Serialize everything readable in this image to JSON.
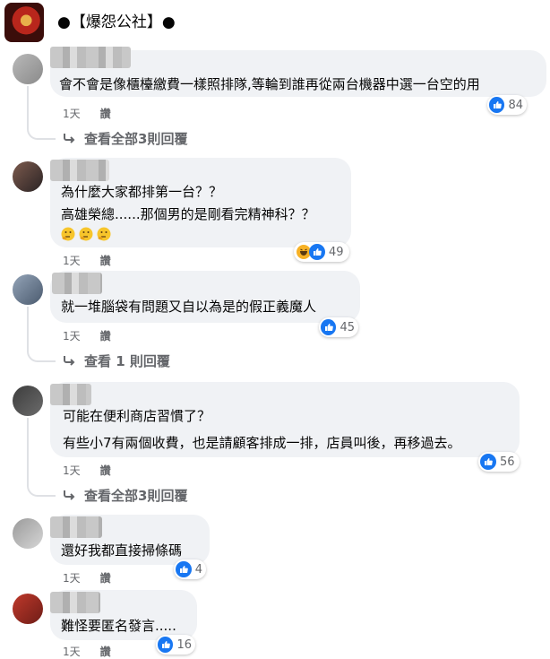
{
  "page": {
    "name": "●【爆怨公社】●"
  },
  "icons": {
    "like": "like-icon",
    "haha": "haha-icon",
    "reply_arrow": "reply-arrow-icon"
  },
  "colors": {
    "like_blue": "#1877f2",
    "bubble_bg": "#f0f2f5",
    "meta_gray": "#65676b"
  },
  "comments": [
    {
      "lines": [
        "會不會是像櫃檯繳費一樣照排隊,等輪到誰再從兩台機器中選一台空的用"
      ],
      "time": "1天",
      "action": "讚",
      "reactions": [
        "like"
      ],
      "count": "84",
      "replies": "查看全部3則回覆"
    },
    {
      "lines": [
        "為什麼大家都排第一台？？",
        "高雄榮總......那個男的是剛看完精神科？？"
      ],
      "emoji_line": [
        "thinking",
        "thinking",
        "thinking"
      ],
      "time": "1天",
      "action": "讚",
      "reactions": [
        "haha",
        "like"
      ],
      "count": "49"
    },
    {
      "lines": [
        "就一堆腦袋有問題又自以為是的假正義魔人"
      ],
      "time": "1天",
      "action": "讚",
      "reactions": [
        "like"
      ],
      "count": "45",
      "replies": "查看 1 則回覆"
    },
    {
      "lines": [
        "可能在便利商店習慣了？",
        "有些小7有兩個收費，也是請顧客排成一排，店員叫後，再移過去。"
      ],
      "time": "1天",
      "action": "讚",
      "reactions": [
        "like"
      ],
      "count": "56",
      "replies": "查看全部3則回覆"
    },
    {
      "lines": [
        "還好我都直接掃條碼"
      ],
      "time": "1天",
      "action": "讚",
      "reactions": [
        "like"
      ],
      "count": "4"
    },
    {
      "lines": [
        "難怪要匿名發言....."
      ],
      "time": "1天",
      "action": "讚",
      "reactions": [
        "like"
      ],
      "count": "16"
    }
  ]
}
